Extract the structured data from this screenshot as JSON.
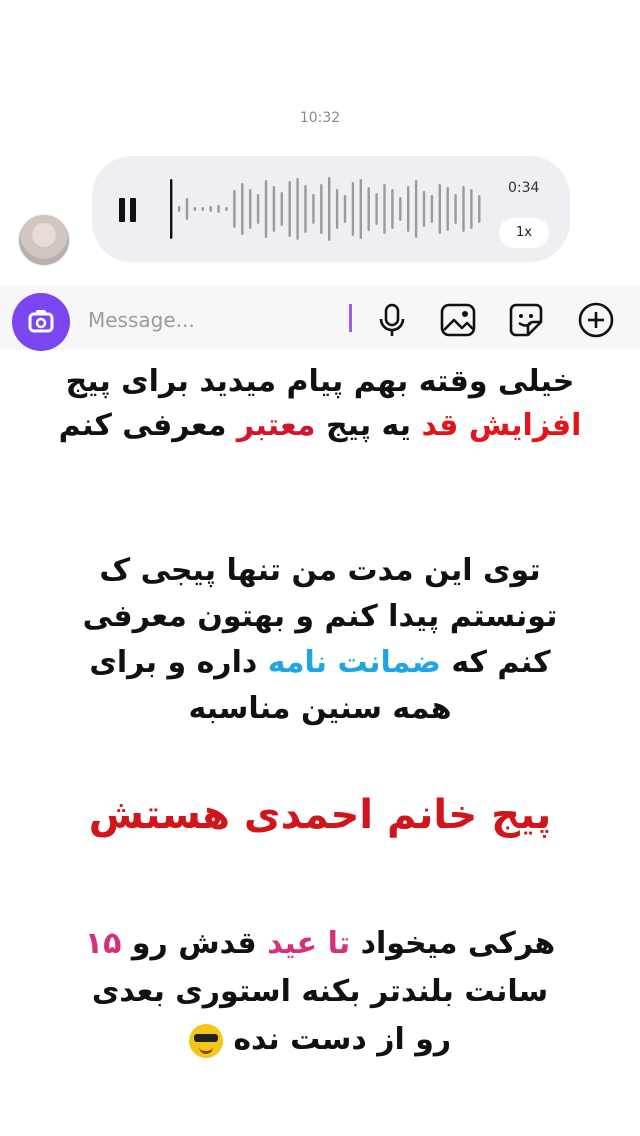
{
  "chat": {
    "timestamp": "10:32",
    "voice_message": {
      "duration": "0:34",
      "speed": "1x",
      "progress": 0.02,
      "state": "playing"
    }
  },
  "composer": {
    "placeholder": "Message...",
    "icons": [
      "camera-icon",
      "microphone-icon",
      "gallery-icon",
      "sticker-icon",
      "plus-icon"
    ],
    "accent": "#7a46f0"
  },
  "story_text": {
    "p1_line1": "خیلی وقته بهم پیام میدید برای پیج",
    "p1_line2_red": "افزایش قد",
    "p1_line2_mid": "یه پیج",
    "p1_line2_red2": "معتبر",
    "p1_line2_end": "معرفی کنم",
    "p2_line1": "توی این مدت من تنها پیجی ک",
    "p2_line2": "تونستم پیدا کنم و بهتون معرفی",
    "p2_line3_start": "کنم که",
    "p2_line3_blue": "ضمانت نامه",
    "p2_line3_end": "داره و برای",
    "p2_line4": "همه سنین مناسبه",
    "p3": "پیج خانم احمدی هستش",
    "p4_line1_start": "هرکی میخواد",
    "p4_line1_pink": "تا عید",
    "p4_line1_mid": "قدش رو",
    "p4_line1_num": "۱۵",
    "p4_line2": "سانت بلندتر بکنه استوری بعدی",
    "p4_line3": "رو از دست نده"
  },
  "colors": {
    "red": "#e3141b",
    "blue": "#1fa6e2",
    "pink": "#d72f7c",
    "bubble": "#efeff3"
  }
}
